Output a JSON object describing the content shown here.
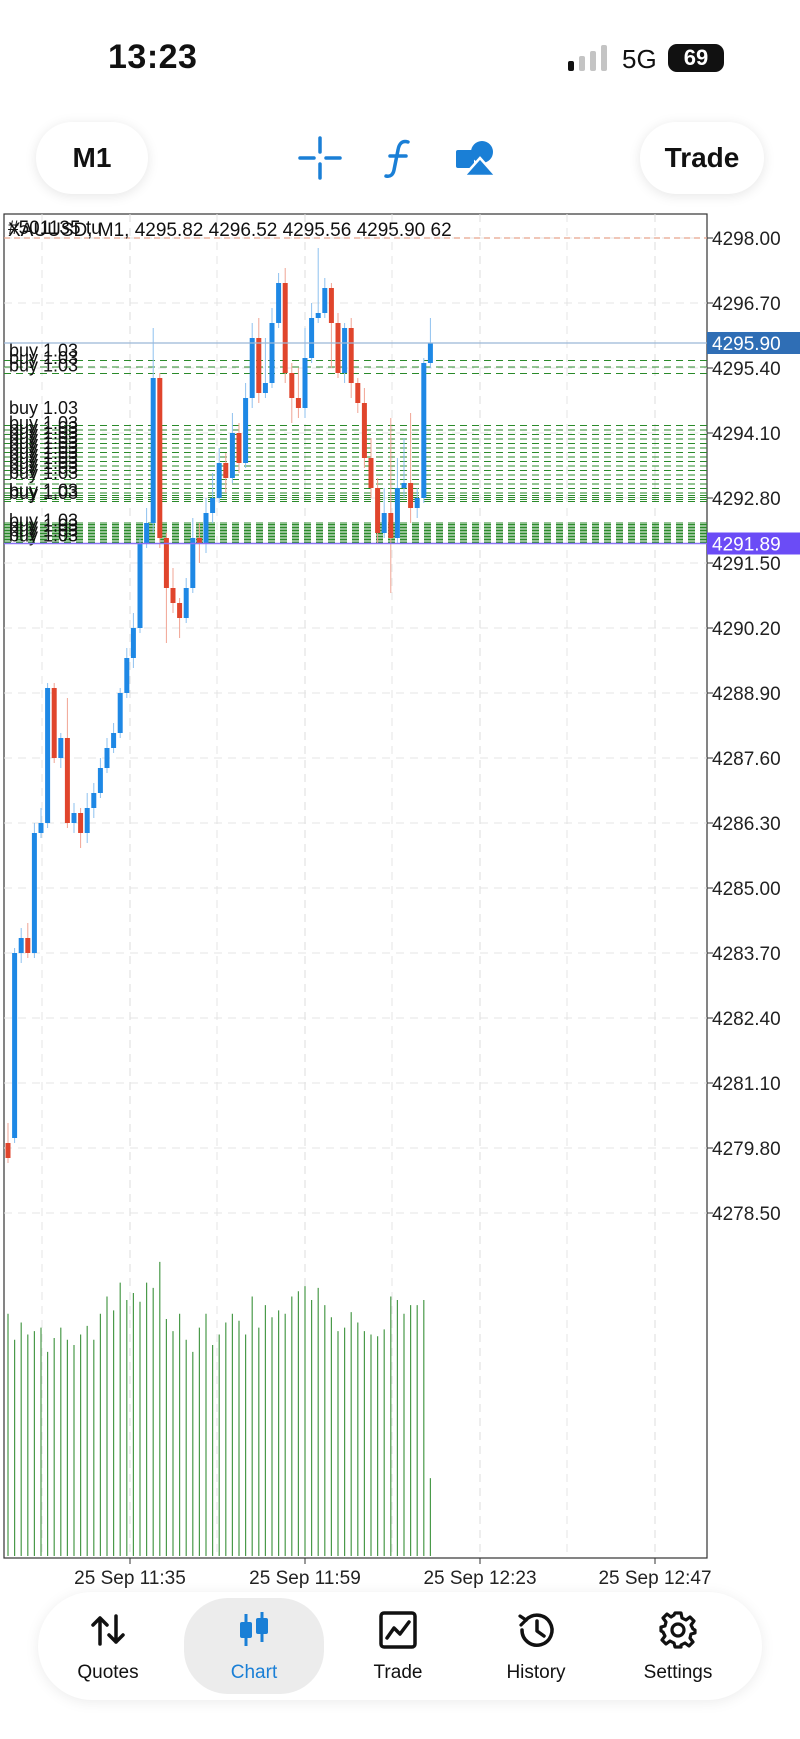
{
  "status": {
    "time": "13:23",
    "network": "5G",
    "battery": "69"
  },
  "toolbar": {
    "timeframe": "M1",
    "trade": "Trade"
  },
  "chart": {
    "header_line1": "#501135 tu",
    "header_line2": "XAUUSD, M1, 4295.82 4296.52 4295.56 4295.90 62",
    "buy_label": "buy 1.03",
    "bid_label": "4295.90",
    "ask_label": "4291.89",
    "bid_color": "#2f6eb5",
    "ask_color": "#6b4cf6",
    "up_color": "#1e88e5",
    "down_color": "#e0452c",
    "volume_color": "#4a9a4a",
    "buy_line_color": "#2a8a2a"
  },
  "chart_data": {
    "type": "candlestick",
    "symbol": "XAUUSD",
    "timeframe": "M1",
    "ylim": [
      4277.2,
      4298.0
    ],
    "y_ticks": [
      "4298.00",
      "4296.70",
      "4295.40",
      "4294.10",
      "4292.80",
      "4291.50",
      "4290.20",
      "4288.90",
      "4287.60",
      "4286.30",
      "4285.00",
      "4283.70",
      "4282.40",
      "4281.10",
      "4279.80",
      "4278.50"
    ],
    "x_ticks": [
      "25 Sep 11:35",
      "25 Sep 11:59",
      "25 Sep 12:23",
      "25 Sep 12:47"
    ],
    "candles": [
      [
        4279.9,
        4279.6,
        4279.5,
        4280.3
      ],
      [
        4280.0,
        4283.7,
        4279.9,
        4283.8
      ],
      [
        4283.7,
        4284.0,
        4283.5,
        4284.2
      ],
      [
        4284.0,
        4283.7,
        4283.6,
        4284.3
      ],
      [
        4283.7,
        4286.1,
        4283.6,
        4286.3
      ],
      [
        4286.1,
        4286.3,
        4286.0,
        4286.6
      ],
      [
        4286.3,
        4289.0,
        4286.2,
        4289.1
      ],
      [
        4289.0,
        4287.6,
        4287.5,
        4289.1
      ],
      [
        4287.6,
        4288.0,
        4287.4,
        4288.1
      ],
      [
        4288.0,
        4286.3,
        4286.2,
        4288.8
      ],
      [
        4286.3,
        4286.5,
        4286.1,
        4286.7
      ],
      [
        4286.5,
        4286.1,
        4285.8,
        4286.6
      ],
      [
        4286.1,
        4286.6,
        4285.9,
        4286.9
      ],
      [
        4286.6,
        4286.9,
        4286.4,
        4287.1
      ],
      [
        4286.9,
        4287.4,
        4286.8,
        4287.6
      ],
      [
        4287.4,
        4287.8,
        4287.3,
        4288.0
      ],
      [
        4287.8,
        4288.1,
        4287.7,
        4288.3
      ],
      [
        4288.1,
        4288.9,
        4288.0,
        4289.0
      ],
      [
        4288.9,
        4289.6,
        4288.8,
        4289.8
      ],
      [
        4289.6,
        4290.2,
        4289.4,
        4290.5
      ],
      [
        4290.2,
        4291.9,
        4290.1,
        4292.0
      ],
      [
        4291.9,
        4292.3,
        4291.8,
        4292.6
      ],
      [
        4292.3,
        4295.2,
        4292.1,
        4296.2
      ],
      [
        4295.2,
        4292.0,
        4291.8,
        4295.3
      ],
      [
        4292.0,
        4291.0,
        4289.9,
        4292.1
      ],
      [
        4291.0,
        4290.7,
        4290.5,
        4291.4
      ],
      [
        4290.7,
        4290.4,
        4290.0,
        4290.8
      ],
      [
        4290.4,
        4291.0,
        4290.3,
        4291.2
      ],
      [
        4291.0,
        4292.0,
        4290.9,
        4292.4
      ],
      [
        4292.0,
        4291.9,
        4291.5,
        4292.3
      ],
      [
        4291.9,
        4292.5,
        4291.7,
        4292.8
      ],
      [
        4292.5,
        4292.8,
        4292.3,
        4293.3
      ],
      [
        4292.8,
        4293.5,
        4292.7,
        4293.8
      ],
      [
        4293.5,
        4293.2,
        4292.9,
        4293.7
      ],
      [
        4293.2,
        4294.1,
        4293.1,
        4294.5
      ],
      [
        4294.1,
        4293.5,
        4293.3,
        4294.3
      ],
      [
        4293.5,
        4294.8,
        4293.4,
        4295.1
      ],
      [
        4294.8,
        4296.0,
        4294.6,
        4296.3
      ],
      [
        4296.0,
        4294.9,
        4294.7,
        4296.4
      ],
      [
        4294.9,
        4295.1,
        4294.8,
        4296.0
      ],
      [
        4295.1,
        4296.3,
        4295.0,
        4296.6
      ],
      [
        4296.3,
        4297.1,
        4296.2,
        4297.3
      ],
      [
        4297.1,
        4295.3,
        4295.1,
        4297.4
      ],
      [
        4295.3,
        4294.8,
        4294.3,
        4295.5
      ],
      [
        4294.8,
        4294.6,
        4294.4,
        4295.4
      ],
      [
        4294.6,
        4295.6,
        4294.4,
        4296.2
      ],
      [
        4295.6,
        4296.4,
        4295.5,
        4296.7
      ],
      [
        4296.4,
        4296.5,
        4296.3,
        4297.8
      ],
      [
        4296.5,
        4297.0,
        4296.4,
        4297.2
      ],
      [
        4297.0,
        4296.3,
        4295.4,
        4297.1
      ],
      [
        4296.3,
        4295.3,
        4295.2,
        4296.5
      ],
      [
        4295.3,
        4296.2,
        4295.1,
        4296.3
      ],
      [
        4296.2,
        4295.1,
        4294.8,
        4296.4
      ],
      [
        4295.1,
        4294.7,
        4294.5,
        4295.2
      ],
      [
        4294.7,
        4293.6,
        4293.4,
        4295.0
      ],
      [
        4293.6,
        4293.0,
        4292.8,
        4294.0
      ],
      [
        4293.0,
        4292.1,
        4291.9,
        4293.2
      ],
      [
        4292.1,
        4292.5,
        4292.0,
        4293.0
      ],
      [
        4292.5,
        4292.0,
        4290.9,
        4294.4
      ],
      [
        4292.0,
        4293.0,
        4291.9,
        4293.6
      ],
      [
        4293.0,
        4293.1,
        4292.8,
        4294.0
      ],
      [
        4293.1,
        4292.6,
        4292.3,
        4294.5
      ],
      [
        4292.6,
        4292.8,
        4292.4,
        4293.0
      ],
      [
        4292.8,
        4295.5,
        4292.7,
        4295.6
      ],
      [
        4295.5,
        4295.9,
        4295.4,
        4296.4
      ]
    ],
    "volumes": [
      140,
      125,
      135,
      128,
      130,
      132,
      118,
      126,
      132,
      125,
      122,
      128,
      133,
      125,
      140,
      150,
      142,
      158,
      148,
      152,
      147,
      158,
      155,
      170,
      137,
      130,
      140,
      125,
      118,
      132,
      140,
      122,
      128,
      135,
      140,
      136,
      128,
      150,
      132,
      145,
      138,
      142,
      140,
      150,
      153,
      156,
      148,
      155,
      145,
      138,
      130,
      132,
      141,
      135,
      130,
      128,
      127,
      131,
      150,
      148,
      140,
      145,
      145,
      148,
      45
    ],
    "volume_max": 200,
    "buy_orders_count": 38
  },
  "nav": {
    "quotes": "Quotes",
    "chart": "Chart",
    "trade": "Trade",
    "history": "History",
    "settings": "Settings"
  }
}
